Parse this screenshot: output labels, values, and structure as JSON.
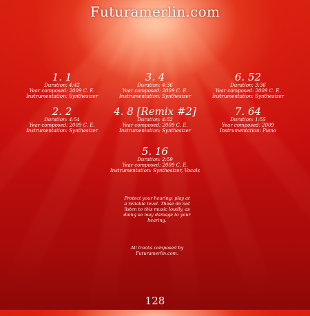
{
  "site_title": "Futuramerlin.com",
  "tracks": [
    {
      "number": "1. 1",
      "lines": [
        "Duration: 4:42",
        "Year composed: 2009 C. E.",
        "Instrumentation: Synthesizer"
      ]
    },
    {
      "number": "2. 2",
      "lines": [
        "Duration: 4:54",
        "Year composed: 2009 C. E.",
        "Instrumentation: Synthesizer"
      ]
    },
    {
      "number": "3. 4",
      "lines": [
        "Duration: 4:36",
        "Year composed: 2009 C. E.",
        "Instrumentation: Synthesizer"
      ]
    },
    {
      "number": "4. 8 [Remix #2]",
      "lines": [
        "Duration: 4:52",
        "Year composed: 2009 C. E.",
        "Instrumentation: Synthesizer"
      ]
    },
    {
      "number": "5. 16",
      "lines": [
        "Duration: 2:59",
        "Year composed: 2009 C. E.",
        "Instrumentation: Synthesizer, Vocals"
      ]
    },
    {
      "number": "6. 52",
      "lines": [
        "Duration: 3:36",
        "Year composed: 2009 C. E.",
        "Instrumentation: Synthesizer"
      ]
    },
    {
      "number": "7. 64",
      "lines": [
        "Duration: 1:55",
        "Year composed: 2009",
        "Instrumentation: Piano"
      ]
    }
  ],
  "notice": "Protect your hearing: play at a reliable level. Those do not listen to this music loudly, as doing so may damage to your hearing.",
  "credit": "All tracks composed by Futuramerlin.com.",
  "page_number": "128"
}
